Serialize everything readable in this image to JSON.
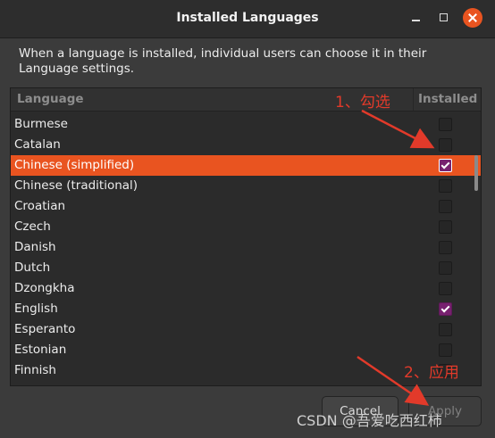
{
  "window": {
    "title": "Installed Languages"
  },
  "description": "When a language is installed, individual users can choose it in their Language settings.",
  "table": {
    "col_language": "Language",
    "col_installed": "Installed",
    "rows": [
      {
        "name": "Burmese",
        "installed": false,
        "selected": false
      },
      {
        "name": "Catalan",
        "installed": false,
        "selected": false
      },
      {
        "name": "Chinese (simplified)",
        "installed": true,
        "selected": true
      },
      {
        "name": "Chinese (traditional)",
        "installed": false,
        "selected": false
      },
      {
        "name": "Croatian",
        "installed": false,
        "selected": false
      },
      {
        "name": "Czech",
        "installed": false,
        "selected": false
      },
      {
        "name": "Danish",
        "installed": false,
        "selected": false
      },
      {
        "name": "Dutch",
        "installed": false,
        "selected": false
      },
      {
        "name": "Dzongkha",
        "installed": false,
        "selected": false
      },
      {
        "name": "English",
        "installed": true,
        "selected": false
      },
      {
        "name": "Esperanto",
        "installed": false,
        "selected": false
      },
      {
        "name": "Estonian",
        "installed": false,
        "selected": false
      },
      {
        "name": "Finnish",
        "installed": false,
        "selected": false
      }
    ]
  },
  "buttons": {
    "cancel": "Cancel",
    "apply": "Apply"
  },
  "annotations": {
    "step1": "1、勾选",
    "step2": "2、应用"
  },
  "watermark": "CSDN @吾爱吃西红柿",
  "colors": {
    "accent": "#e95420",
    "checkbox": "#77216f",
    "annotation": "#e23a2a"
  }
}
